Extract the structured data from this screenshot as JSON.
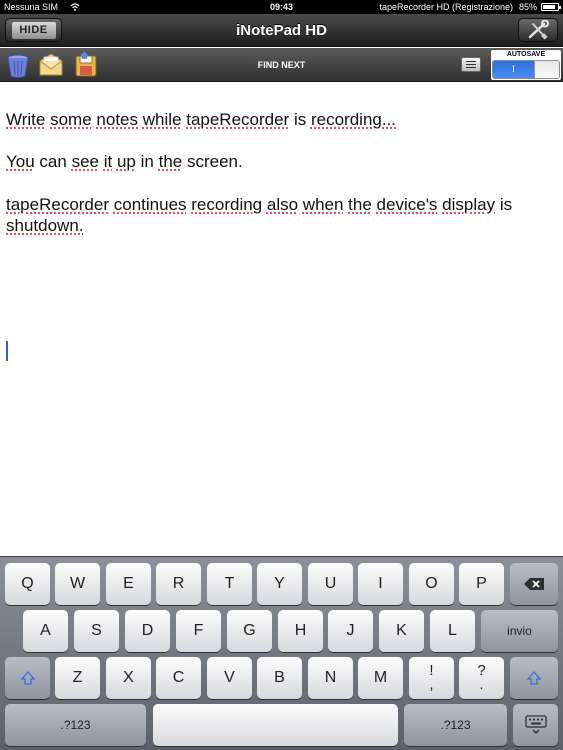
{
  "status_bar": {
    "carrier": "Nessuna SIM",
    "time": "09:43",
    "app_status": "tapeRecorder HD (Registrazione)",
    "battery": "85%",
    "battery_level": 0.85
  },
  "title_bar": {
    "title": "iNotePad HD",
    "hide_label": "HIDE"
  },
  "toolbar": {
    "find_next_label": "FIND NEXT",
    "autosave_label": "AUTOSAVE",
    "autosave_on_label": "I",
    "autosave_on": true
  },
  "note": {
    "lines": [
      "Write some notes while tapeRecorder is recording...",
      "You can see it up in the screen.",
      "tapeRecorder continues recording also when the device's display is shutdown."
    ]
  },
  "keyboard": {
    "row1": [
      "Q",
      "W",
      "E",
      "R",
      "T",
      "Y",
      "U",
      "I",
      "O",
      "P"
    ],
    "row2": [
      "A",
      "S",
      "D",
      "F",
      "G",
      "H",
      "J",
      "K",
      "L"
    ],
    "return_label": "invio",
    "row3": [
      "Z",
      "X",
      "C",
      "V",
      "B",
      "N",
      "M"
    ],
    "exclaim_top": "!",
    "exclaim_bottom": ",",
    "question_top": "?",
    "question_bottom": ".",
    "numbers_label": ".?123"
  },
  "colors": {
    "accent": "#2e6fe0",
    "caret": "#3a5ec9",
    "spell_underline": "#dd3333"
  },
  "icons": [
    "trash-icon",
    "mail-icon",
    "save-icon",
    "wrench-screwdriver-icon",
    "list-icon",
    "backspace-icon",
    "shift-icon",
    "keyboard-dismiss-icon",
    "wifi-icon",
    "battery-icon"
  ]
}
